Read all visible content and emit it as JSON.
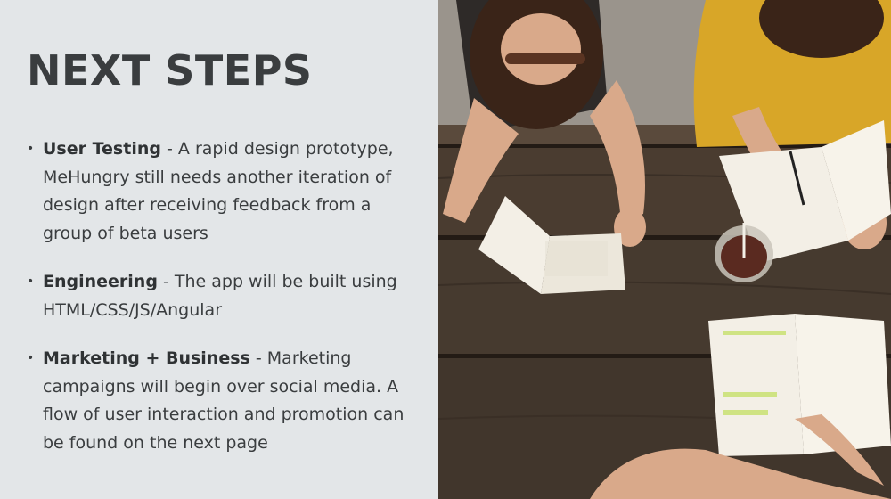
{
  "slide": {
    "title": "NEXT STEPS",
    "bullets": [
      {
        "term": "User Testing",
        "text": " - A rapid design prototype, MeHungry still needs another iteration of design after receiving feedback from a group of beta users"
      },
      {
        "term": "Engineering",
        "text": " - The app will be built using HTML/CSS/JS/Angular"
      },
      {
        "term": "Marketing + Business",
        "text": " - Marketing campaigns will begin over social media. A flow of user interaction and promotion can be found on the next page"
      }
    ]
  },
  "photo": {
    "colors": {
      "table_wood": "#4a3c30",
      "table_dark": "#2c231c",
      "ground": "#9a948c",
      "hair": "#3a2418",
      "skin": "#d9a98a",
      "yellow_top": "#d8a628",
      "paper": "#f3efe6",
      "highlight": "#c6e06a"
    }
  }
}
